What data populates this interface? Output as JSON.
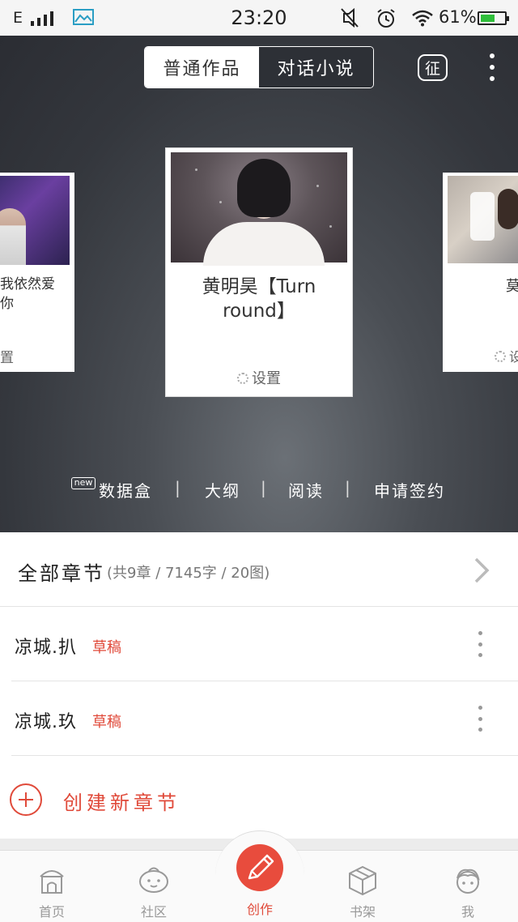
{
  "status_bar": {
    "network": "E",
    "time": "23:20",
    "battery": "61%",
    "battery_level": 0.61
  },
  "header": {
    "toggle": [
      "普通作品",
      "对话小说"
    ],
    "badge": "征"
  },
  "cards": {
    "left": {
      "title": "我依然爱\n你",
      "settings": "置"
    },
    "center": {
      "title": "黄明昊【Turn round】",
      "settings": "设置"
    },
    "right": {
      "title": "莫",
      "settings": "设"
    }
  },
  "actions": {
    "new_badge": "new",
    "items": [
      "数据盒",
      "大纲",
      "阅读",
      "申请签约"
    ]
  },
  "chapters": {
    "all_label": "全部章节",
    "all_meta": "(共9章 / 7145字 / 20图)",
    "items": [
      {
        "name": "凉城.扒",
        "status": "草稿"
      },
      {
        "name": "凉城.玖",
        "status": "草稿"
      }
    ],
    "create_label": "创建新章节"
  },
  "tabbar": {
    "items": [
      "首页",
      "社区",
      "创作",
      "书架",
      "我"
    ]
  },
  "colors": {
    "accent": "#e04a3a",
    "hero_bg": "#34373d",
    "battery": "#2fbf3a"
  }
}
